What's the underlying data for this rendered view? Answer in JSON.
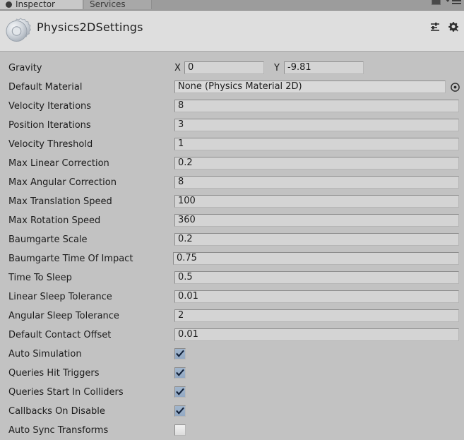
{
  "tabs": [
    {
      "label": "Inspector",
      "active": true,
      "icon": "inspector-icon"
    },
    {
      "label": "Services",
      "active": false,
      "icon": "services-icon"
    }
  ],
  "tabbar": {
    "lock_icon": "lock-icon",
    "menu_icon": "hamburger-menu-icon"
  },
  "header": {
    "title": "Physics2DSettings",
    "icon": "gear-cog-icon",
    "presets_icon": "presets-sliders-icon",
    "settings_icon": "gear-dropdown-icon"
  },
  "colors": {
    "panel_bg": "#c2c2c2",
    "header_bg": "#dedede",
    "field_bg": "#d4d4d4",
    "checkbox_on": "#93a9c3",
    "text": "#1c1c1c"
  },
  "properties": [
    {
      "label": "Gravity",
      "type": "vector2",
      "axis_x_label": "X",
      "axis_y_label": "Y",
      "x": "0",
      "y": "-9.81"
    },
    {
      "label": "Default Material",
      "type": "object",
      "value": "None (Physics Material 2D)",
      "picker_icon": "object-picker-icon"
    },
    {
      "label": "Velocity Iterations",
      "type": "number",
      "value": "8"
    },
    {
      "label": "Position Iterations",
      "type": "number",
      "value": "3"
    },
    {
      "label": "Velocity Threshold",
      "type": "number",
      "value": "1"
    },
    {
      "label": "Max Linear Correction",
      "type": "number",
      "value": "0.2"
    },
    {
      "label": "Max Angular Correction",
      "type": "number",
      "value": "8"
    },
    {
      "label": "Max Translation Speed",
      "type": "number",
      "value": "100"
    },
    {
      "label": "Max Rotation Speed",
      "type": "number",
      "value": "360"
    },
    {
      "label": "Baumgarte Scale",
      "type": "number",
      "value": "0.2"
    },
    {
      "label": "Baumgarte Time Of Impact",
      "type": "number",
      "value": "0.75"
    },
    {
      "label": "Time To Sleep",
      "type": "number",
      "value": "0.5"
    },
    {
      "label": "Linear Sleep Tolerance",
      "type": "number",
      "value": "0.01"
    },
    {
      "label": "Angular Sleep Tolerance",
      "type": "number",
      "value": "2"
    },
    {
      "label": "Default Contact Offset",
      "type": "number",
      "value": "0.01"
    },
    {
      "label": "Auto Simulation",
      "type": "checkbox",
      "checked": true
    },
    {
      "label": "Queries Hit Triggers",
      "type": "checkbox",
      "checked": true
    },
    {
      "label": "Queries Start In Colliders",
      "type": "checkbox",
      "checked": true
    },
    {
      "label": "Callbacks On Disable",
      "type": "checkbox",
      "checked": true
    },
    {
      "label": "Auto Sync Transforms",
      "type": "checkbox",
      "checked": false
    }
  ]
}
